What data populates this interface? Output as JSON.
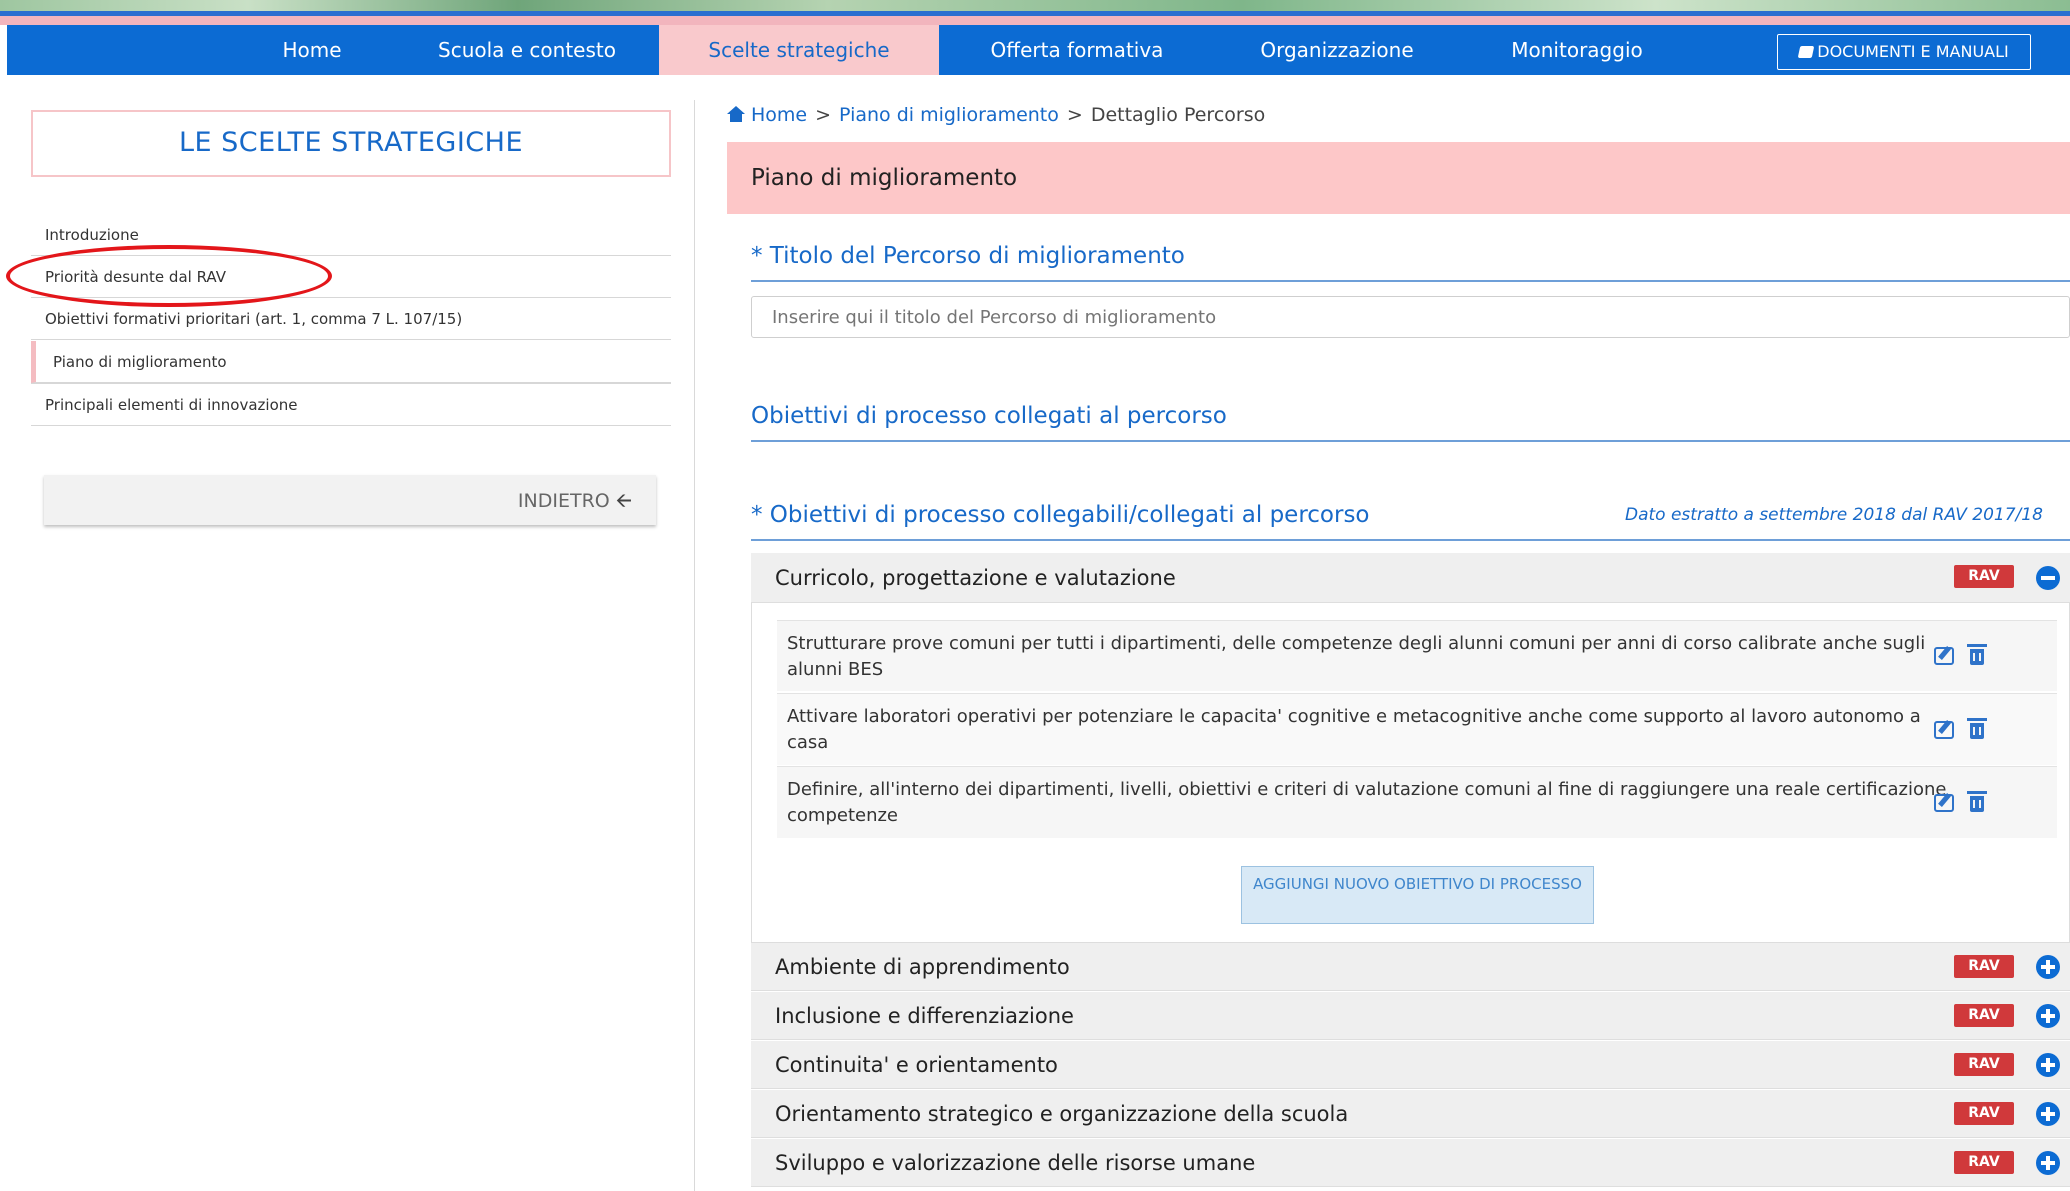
{
  "nav": {
    "items": [
      "Home",
      "Scuola e contesto",
      "Scelte strategiche",
      "Offerta formativa",
      "Organizzazione",
      "Monitoraggio"
    ],
    "active_index": 2,
    "docs_label": "DOCUMENTI E MANUALI"
  },
  "sidebar": {
    "title": "LE SCELTE STRATEGICHE",
    "items": [
      "Introduzione",
      "Priorità desunte dal RAV",
      "Obiettivi formativi prioritari (art. 1, comma 7 L. 107/15)",
      "Piano di miglioramento",
      "Principali elementi di innovazione"
    ],
    "active_index": 3,
    "back_label": "INDIETRO"
  },
  "breadcrumb": {
    "home": "Home",
    "sep": ">",
    "parent": "Piano di miglioramento",
    "current": "Dettaglio Percorso"
  },
  "main": {
    "header": "Piano di miglioramento",
    "title_section": "* Titolo del Percorso di miglioramento",
    "title_placeholder": "Inserire qui il titolo del Percorso di miglioramento",
    "linked_section": "Obiettivi di processo collegati al percorso",
    "linkable_section": "* Obiettivi di processo collegabili/collegati al percorso",
    "extract_note": "Dato estratto a settembre 2018 dal RAV 2017/18",
    "badge": "RAV",
    "expanded_area": {
      "name": "Curricolo, progettazione e valutazione",
      "objectives": [
        "Strutturare prove comuni per tutti i dipartimenti, delle competenze degli alunni comuni per anni di corso calibrate anche sugli alunni BES",
        "Attivare laboratori operativi per potenziare le capacita' cognitive e metacognitive anche come supporto al lavoro autonomo a casa",
        "Definire, all'interno dei dipartimenti, livelli, obiettivi e criteri di valutazione comuni al fine di raggiungere una reale certificazione competenze"
      ],
      "add_label": "AGGIUNGI NUOVO OBIETTIVO DI PROCESSO"
    },
    "collapsed_areas": [
      "Ambiente di apprendimento",
      "Inclusione e differenziazione",
      "Continuita' e orientamento",
      "Orientamento strategico e organizzazione della scuola",
      "Sviluppo e valorizzazione delle risorse umane"
    ]
  }
}
